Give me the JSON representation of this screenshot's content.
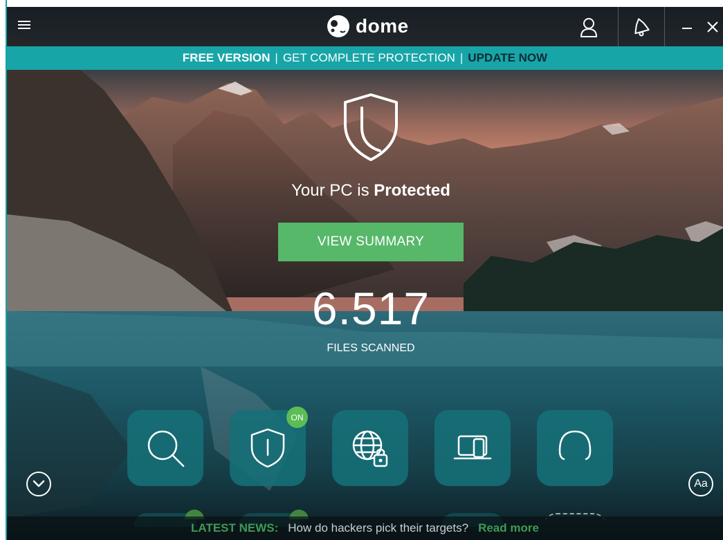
{
  "app": {
    "logo_text": "dome",
    "logo_small": "panda"
  },
  "banner": {
    "free_version": "FREE VERSION",
    "separator": "|",
    "get_protection": "GET COMPLETE PROTECTION",
    "update_now": "UPDATE NOW"
  },
  "status": {
    "prefix": "Your PC is ",
    "state": "Protected"
  },
  "view_summary": "VIEW SUMMARY",
  "scan": {
    "count": "6.517",
    "label": "FILES SCANNED"
  },
  "tiles": [
    {
      "icon": "search-icon"
    },
    {
      "icon": "shield-icon",
      "badge": "ON"
    },
    {
      "icon": "globe-lock-icon"
    },
    {
      "icon": "devices-icon"
    },
    {
      "icon": "headset-icon"
    }
  ],
  "font_button": "Aa",
  "news": {
    "label": "LATEST NEWS:",
    "text": "How do hackers pick their targets?",
    "link": "Read more"
  },
  "colors": {
    "accent": "#18a5a8",
    "green": "#57b86a",
    "tile": "#167078"
  }
}
